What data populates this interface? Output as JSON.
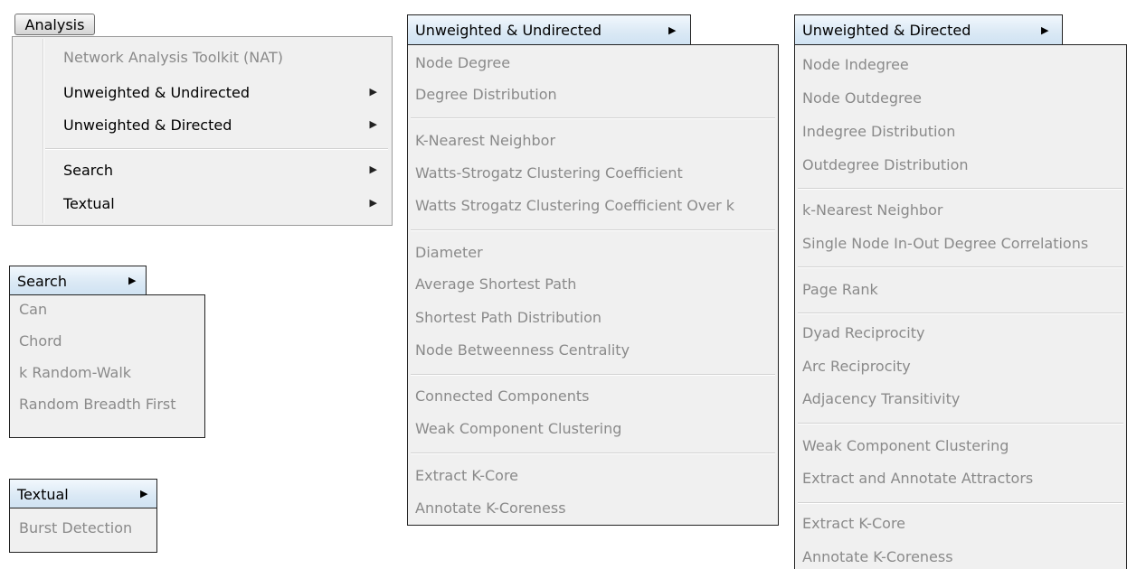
{
  "analysis_menu": {
    "button_label": "Analysis",
    "items": [
      "Network Analysis Toolkit (NAT)",
      "Unweighted & Undirected",
      "Unweighted & Directed",
      "Search",
      "Textual"
    ],
    "submenu_arrow": "▶"
  },
  "search_menu": {
    "title": "Search",
    "items": [
      "Can",
      "Chord",
      "k Random-Walk",
      "Random Breadth First"
    ]
  },
  "textual_menu": {
    "title": "Textual",
    "items": [
      "Burst Detection"
    ]
  },
  "undirected_menu": {
    "title": "Unweighted & Undirected",
    "items": [
      "Node Degree",
      "Degree Distribution",
      "K-Nearest Neighbor",
      "Watts-Strogatz Clustering Coefficient",
      "Watts Strogatz Clustering Coefficient Over k",
      "Diameter",
      "Average Shortest Path",
      "Shortest Path Distribution",
      "Node Betweenness Centrality",
      "Connected Components",
      "Weak Component Clustering",
      "Extract K-Core",
      "Annotate K-Coreness"
    ]
  },
  "directed_menu": {
    "title": "Unweighted & Directed",
    "items": [
      "Node Indegree",
      "Node Outdegree",
      "Indegree Distribution",
      "Outdegree Distribution",
      "k-Nearest Neighbor",
      "Single Node In-Out Degree Correlations",
      "Page Rank",
      "Dyad Reciprocity",
      "Arc Reciprocity",
      "Adjacency Transitivity",
      "Weak Component Clustering",
      "Extract and Annotate Attractors",
      "Extract K-Core",
      "Annotate K-Coreness"
    ]
  }
}
